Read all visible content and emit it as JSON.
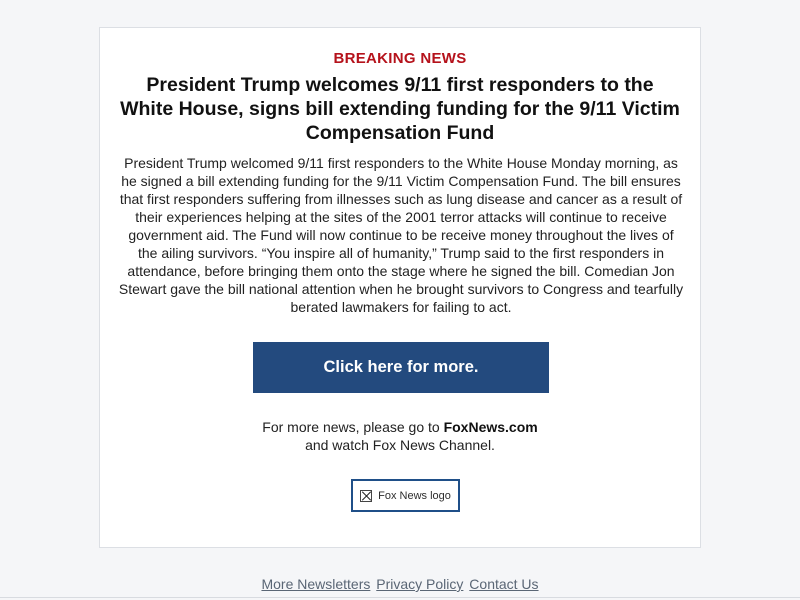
{
  "email": {
    "kicker": "BREAKING NEWS",
    "headline": "President Trump welcomes 9/11 first responders to the White House, signs bill extending funding for the 9/11 Victim Compensation Fund",
    "body": "President Trump welcomed 9/11 first responders to the White House Monday morning, as he signed a bill extending funding for the 9/11 Victim Compensation Fund. The bill ensures that first responders suffering from illnesses such as lung disease and cancer as a result of their experiences helping at the sites of the 2001 terror attacks will continue to receive government aid. The Fund will now continue to be receive money throughout the lives of the ailing survivors. “You inspire all of humanity,” Trump said to the first responders in attendance, before bringing them onto the stage where he signed the bill. Comedian Jon Stewart gave the bill national attention when he brought survivors to Congress and tearfully berated lawmakers for failing to act.",
    "cta_label": "Click here for more.",
    "more_news_prefix": "For more news, please go to ",
    "more_news_site": "FoxNews.com",
    "more_news_suffix": "and watch Fox News Channel.",
    "logo_alt": "Fox News logo"
  },
  "footer": {
    "links": [
      "More Newsletters",
      "Privacy Policy",
      "Contact Us"
    ]
  },
  "colors": {
    "kicker": "#b5121b",
    "cta_background": "#234a7e",
    "logo_border": "#1f4f88",
    "page_background": "#f5f6f8"
  },
  "icons": {
    "logo_placeholder": "broken-image-icon"
  }
}
